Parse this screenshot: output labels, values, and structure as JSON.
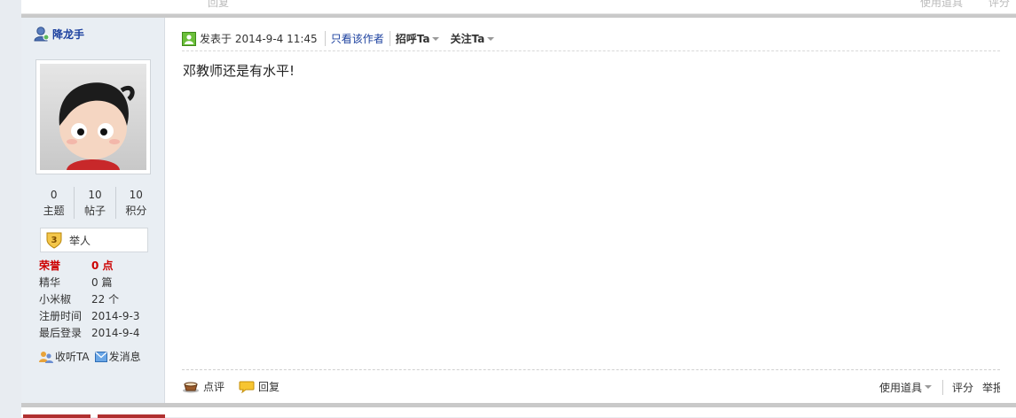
{
  "top_strip": {
    "left_ghost": "回复",
    "right_ghost_1": "使用道具",
    "right_ghost_2": "评分"
  },
  "author": {
    "name": "降龙手"
  },
  "stats": [
    {
      "value": "0",
      "label": "主题"
    },
    {
      "value": "10",
      "label": "帖子"
    },
    {
      "value": "10",
      "label": "积分"
    }
  ],
  "rank": {
    "level": "3",
    "title": "举人"
  },
  "profile": {
    "honor_label": "荣誉",
    "honor_value": "0 点",
    "digest_label": "精华",
    "digest_value": "0 篇",
    "pepper_label": "小米椒",
    "pepper_value": "22 个",
    "reg_label": "注册时间",
    "reg_value": "2014-9-3",
    "last_label": "最后登录",
    "last_value": "2014-9-4"
  },
  "actions": {
    "follow": "收听TA",
    "message": "发消息"
  },
  "post": {
    "posted_at": "发表于 2014-9-4 11:45",
    "only_author": "只看该作者",
    "greet": "招呼Ta",
    "follow": "关注Ta",
    "content": "邓教师还是有水平!"
  },
  "footer": {
    "comment": "点评",
    "reply": "回复",
    "use_tool": "使用道具",
    "rate": "评分",
    "report": "举报"
  }
}
